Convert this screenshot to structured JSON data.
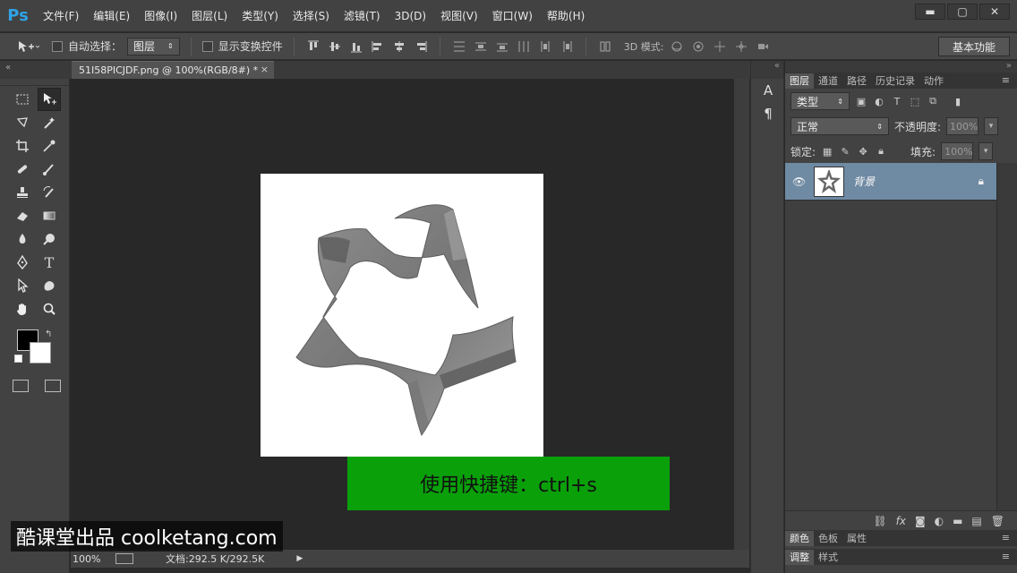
{
  "app": {
    "logo": "Ps"
  },
  "menu": [
    "文件(F)",
    "编辑(E)",
    "图像(I)",
    "图层(L)",
    "类型(Y)",
    "选择(S)",
    "滤镜(T)",
    "3D(D)",
    "视图(V)",
    "窗口(W)",
    "帮助(H)"
  ],
  "window_controls": {
    "minimize": "▬",
    "maximize": "▢",
    "close": "✕"
  },
  "options": {
    "auto_select_label": "自动选择：",
    "auto_select_value": "图层",
    "show_transform_label": "显示变换控件",
    "mode_3d_label": "3D 模式:",
    "workspace": "基本功能"
  },
  "document": {
    "tab_title": "51I58PICJDF.png @ 100%(RGB/8#) *",
    "close": "×"
  },
  "status": {
    "zoom": "100%",
    "doc_size": "文档:292.5 K/292.5K",
    "arrow": "▶"
  },
  "overlay": {
    "shortcut": "使用快捷键：ctrl+s",
    "watermark": "酷课堂出品 coolketang.com"
  },
  "mini_panel": {
    "char_icon": "A",
    "para_icon": "¶"
  },
  "layers_panel": {
    "tabs": [
      "图层",
      "通道",
      "路径",
      "历史记录",
      "动作"
    ],
    "filter_label": "类型",
    "blend_mode": "正常",
    "opacity_label": "不透明度:",
    "opacity_value": "100%",
    "lock_label": "锁定:",
    "fill_label": "填充:",
    "fill_value": "100%",
    "layers": [
      {
        "name": "背景",
        "visible": true,
        "locked": true
      }
    ]
  },
  "bottom_panels": {
    "row1_tabs": [
      "颜色",
      "色板",
      "属性"
    ],
    "row2_tabs": [
      "调整",
      "样式"
    ]
  }
}
